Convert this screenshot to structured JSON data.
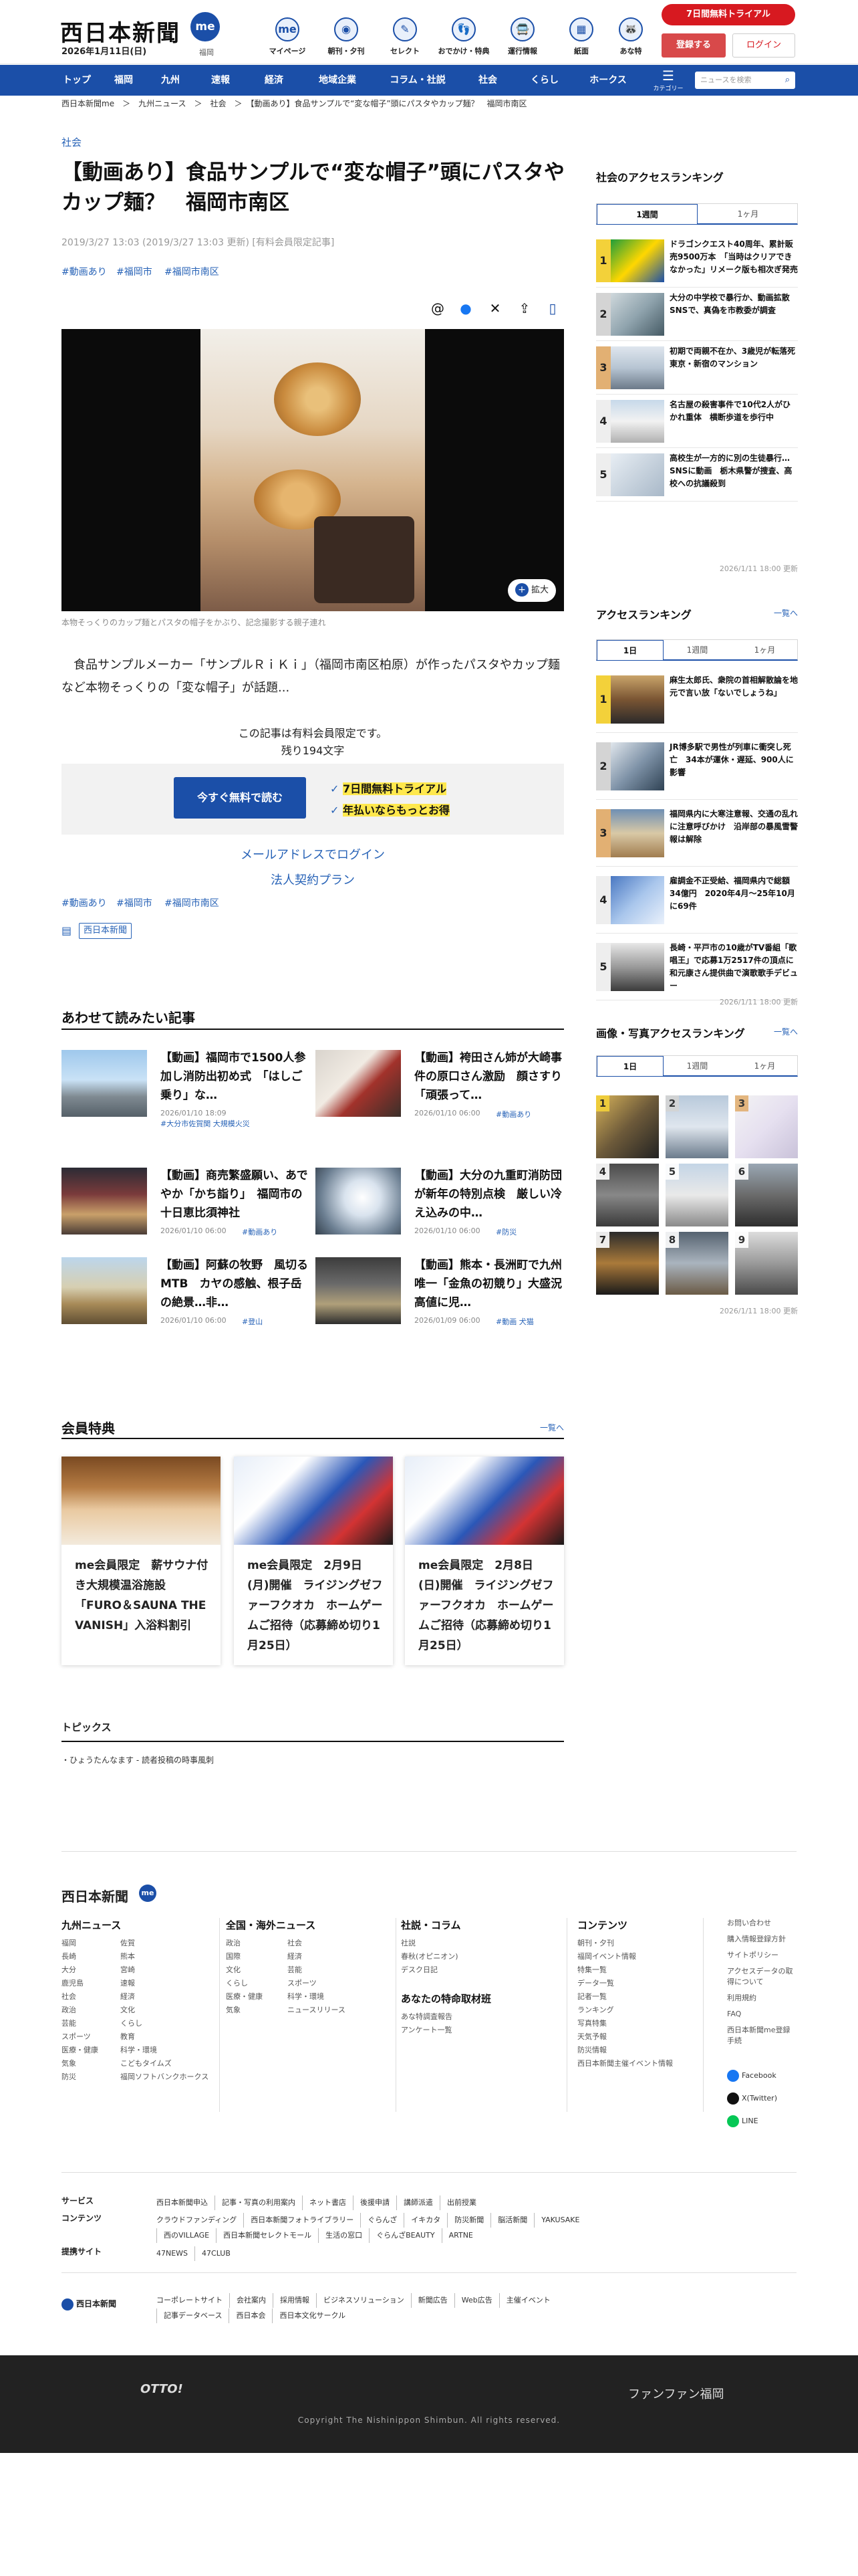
{
  "header": {
    "logo": "西日本新聞",
    "logo_me": "me",
    "date": "2026年1月11日(日)",
    "region": "福岡",
    "icons": [
      {
        "label": "マイページ",
        "glyph": "me"
      },
      {
        "label": "朝刊・夕刊",
        "glyph": "◉"
      },
      {
        "label": "セレクト",
        "glyph": "✎"
      },
      {
        "label": "おでかけ・特典",
        "glyph": "👣"
      },
      {
        "label": "運行情報",
        "glyph": "🚍"
      },
      {
        "label": "紙面",
        "glyph": "▦"
      },
      {
        "label": "あな特",
        "glyph": "🦝"
      }
    ],
    "trial": "7日間無料トライアル",
    "register": "登録する",
    "login": "ログイン"
  },
  "nav": {
    "items": [
      "トップ",
      "福岡",
      "九州",
      "速報",
      "経済",
      "地域企業",
      "コラム・社説",
      "社会",
      "くらし",
      "ホークス"
    ],
    "category": "カテゴリー",
    "search_placeholder": "ニュースを検索"
  },
  "breadcrumb": "西日本新聞me　＞　九州ニュース　＞　社会　＞　【動画あり】食品サンプルで“変な帽子”頭にパスタやカップ麺？　福岡市南区",
  "article": {
    "category": "社会",
    "title": "【動画あり】食品サンプルで“変な帽子”頭にパスタやカップ麺？　福岡市南区",
    "meta": "2019/3/27 13:03 (2019/3/27 13:03 更新) [有料会員限定記事]",
    "tags": [
      "#動画あり",
      "#福岡市",
      "#福岡市南区"
    ],
    "zoom": "拡大",
    "caption": "本物そっくりのカップ麺とパスタの帽子をかぶり、記念撮影する親子連れ",
    "lead": "　食品サンプルメーカー「サンプルＲｉＫｉ」（福岡市南区柏原）が作ったパスタやカップ麺など本物そっくりの「変な帽子」が話題...",
    "members_only": "この記事は有料会員限定です。",
    "remaining": "残り194文字",
    "read_free": "今すぐ無料で読む",
    "trial_check": "7日間無料トライアル",
    "yearly_check": "年払いならもっとお得",
    "email_login": "メールアドレスでログイン",
    "corporate": "法人契約プラン",
    "tags2": [
      "#動画あり",
      "#福岡市",
      "#福岡市南区"
    ],
    "source_tag": "西日本新聞"
  },
  "related": {
    "title": "あわせて読みたい記事",
    "items": [
      {
        "title": "【動画】福岡市で1500人参加し消防出初め式　「はしご乗り」な…",
        "date": "2026/01/10 18:09",
        "tag": "#大分市佐賀関 大規模火災"
      },
      {
        "title": "【動画】袴田さん姉が大崎事件の原口さん激励　顔さすり「頑張って…",
        "date": "2026/01/10 06:00",
        "tag": "#動画あり"
      },
      {
        "title": "【動画】商売繁盛願い、あでやか「かち詣り」　福岡市の十日恵比須神社",
        "date": "2026/01/10 06:00",
        "tag": "#動画あり"
      },
      {
        "title": "【動画】大分の九重町消防団が新年の特別点検　厳しい冷え込みの中…",
        "date": "2026/01/10 06:00",
        "tag": "#防災"
      },
      {
        "title": "【動画】阿蘇の牧野　風切るMTB　カヤの感触、根子岳の絶景…非…",
        "date": "2026/01/10 06:00",
        "tag": "#登山"
      },
      {
        "title": "【動画】熊本・長洲町で九州唯一「金魚の初競り」大盛況　高値に児…",
        "date": "2026/01/09 06:00",
        "tag": "#動画 犬猫"
      }
    ]
  },
  "benefits": {
    "title": "会員特典",
    "more": "一覧へ",
    "items": [
      {
        "title": "me会員限定　薪サウナ付き大規模温浴施設「FURO＆SAUNA THE VANISH」入浴料割引"
      },
      {
        "title": "me会員限定　2月9日(月)開催　ライジングゼファーフクオカ　ホームゲームご招待（応募締め切り1月25日）"
      },
      {
        "title": "me会員限定　2月8日(日)開催　ライジングゼファーフクオカ　ホームゲームご招待（応募締め切り1月25日）"
      }
    ]
  },
  "topics": {
    "title": "トピックス",
    "item": "ひょうたんなます - 読者投稿の時事風刺"
  },
  "sidebar": {
    "social": {
      "title": "社会のアクセスランキング",
      "tabs": [
        "1週間",
        "1ヶ月"
      ],
      "items": [
        "ドラゴンクエスト40周年、累計販売9500万本　「当時はクリアできなかった」リメーク版も相次ぎ発売",
        "大分の中学校で暴行か、動画拡散　SNSで、真偽を市教委が調査",
        "初期で両親不在か、3歳児が転落死　東京・新宿のマンション",
        "名古屋の殺害事件で10代2人がひかれ重体　横断歩道を歩行中",
        "高校生が一方的に別の生徒暴行…SNSに動画　栃木県警が捜査、高校への抗議殺到"
      ],
      "updated": "2026/1/11 18:00 更新"
    },
    "access": {
      "title": "アクセスランキング",
      "more": "一覧へ",
      "tabs": [
        "1日",
        "1週間",
        "1ヶ月"
      ],
      "items": [
        "麻生太郎氏、衆院の首相解散論を地元で言い放「ないでしょうね」",
        "JR博多駅で男性が列車に衝突し死亡　34本が運休・遅延、900人に影響",
        "福岡県内に大寒注意報、交通の乱れに注意呼びかけ　沿岸部の暴風雪警報は解除",
        "雇調金不正受給、福岡県内で総額34億円　2020年4月～25年10月に69件",
        "長崎・平戸市の10歳がTV番組「歌唱王」で応募1万2517件の頂点に　和元康さん提供曲で演歌歌手デビュー"
      ],
      "updated": "2026/1/11 18:00 更新"
    },
    "photo": {
      "title": "画像・写真アクセスランキング",
      "more": "一覧へ",
      "tabs": [
        "1日",
        "1週間",
        "1ヶ月"
      ],
      "nums": [
        "1",
        "2",
        "3",
        "4",
        "5",
        "6",
        "7",
        "8",
        "9"
      ],
      "updated": "2026/1/11 18:00 更新"
    }
  },
  "footer": {
    "logo": "西日本新聞",
    "logo_me": "me",
    "kyushu": {
      "title": "九州ニュース",
      "col1": [
        "福岡",
        "長崎",
        "大分",
        "鹿児島",
        "社会",
        "政治",
        "芸能",
        "スポーツ",
        "医療・健康",
        "気象",
        "防災"
      ],
      "col2": [
        "佐賀",
        "熊本",
        "宮崎",
        "速報",
        "経済",
        "文化",
        "くらし",
        "教育",
        "科学・環境",
        "こどもタイムズ",
        "福岡ソフトバンクホークス"
      ]
    },
    "national": {
      "title": "全国・海外ニュース",
      "col1": [
        "政治",
        "国際",
        "文化",
        "くらし",
        "医療・健康",
        "気象"
      ],
      "col2": [
        "社会",
        "経済",
        "芸能",
        "スポーツ",
        "科学・環境",
        "ニュースリリース"
      ]
    },
    "column": {
      "title": "社説・コラム",
      "items": [
        "社説",
        "春秋(オピニオン)",
        "デスク日記"
      ],
      "special_title": "あなたの特命取材班",
      "special": [
        "あな特調査報告",
        "アンケート一覧"
      ]
    },
    "contents": {
      "title": "コンテンツ",
      "items": [
        "朝刊・夕刊",
        "福岡イベント情報",
        "特集一覧",
        "データ一覧",
        "記者一覧",
        "ランキング",
        "写真特集",
        "天気予報",
        "防災情報",
        "西日本新聞主催イベント情報"
      ]
    },
    "help": {
      "items": [
        "お問い合わせ",
        "購入情報登録方針",
        "サイトポリシー",
        "アクセスデータの取得について",
        "利用規約",
        "FAQ",
        "西日本新聞me登録手続"
      ],
      "sns": [
        "Facebook",
        "X(Twitter)",
        "LINE"
      ]
    },
    "services": {
      "label": "サービス",
      "items": [
        "西日本新聞申込",
        "記事・写真の利用案内",
        "ネット書店",
        "後援申請",
        "講師派遣",
        "出前授業"
      ]
    },
    "contents_row": {
      "label": "コンテンツ",
      "items": [
        "クラウドファンディング",
        "西日本新聞フォトライブラリー",
        "ぐらんざ",
        "イキカタ",
        "防災新聞",
        "脳活新聞",
        "YAKUSAKE",
        "西のVILLAGE",
        "西日本新聞セレクトモール",
        "生活の窓口",
        "ぐらんざBEAUTY",
        "ARTNE"
      ]
    },
    "partners": {
      "label": "提携サイト",
      "items": [
        "47NEWS",
        "47CLUB"
      ]
    },
    "corp_logo": "西日本新聞",
    "corp_links": [
      "コーポレートサイト",
      "会社案内",
      "採用情報",
      "ビジネスソリューション",
      "新聞広告",
      "Web広告",
      "主催イベント",
      "記事データベース",
      "西日本会",
      "西日本文化サークル"
    ],
    "otto": "OTTO!",
    "funfun": "ファンファン福岡",
    "copyright": "Copyright The Nishinippon Shimbun. All rights reserved."
  }
}
